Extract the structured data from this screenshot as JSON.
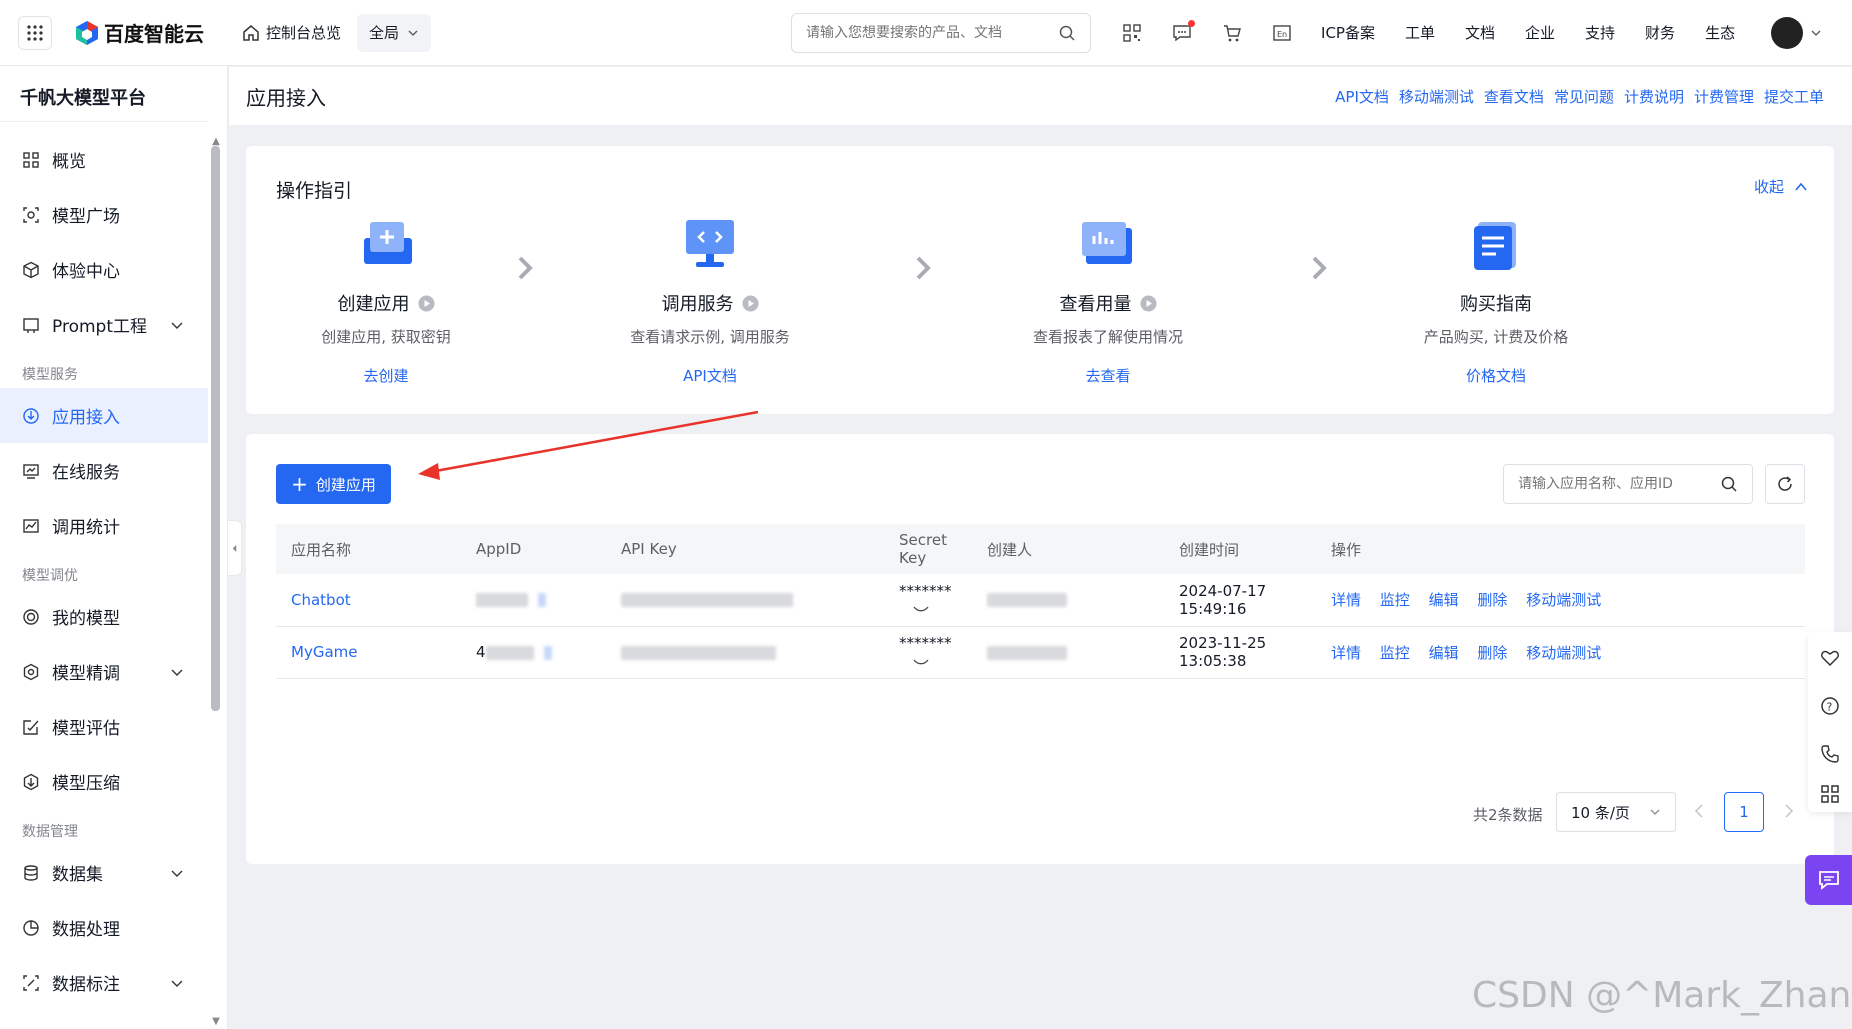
{
  "topbar": {
    "brand": "百度智能云",
    "console_home": "控制台总览",
    "region": "全局",
    "search_placeholder": "请输入您想要搜索的产品、文档",
    "links": [
      "ICP备案",
      "工单",
      "文档",
      "企业",
      "支持",
      "财务",
      "生态"
    ]
  },
  "sidebar": {
    "title": "千帆大模型平台",
    "items_top": [
      {
        "label": "概览",
        "icon": "grid-icon"
      },
      {
        "label": "模型广场",
        "icon": "model-square-icon"
      },
      {
        "label": "体验中心",
        "icon": "cube-icon"
      },
      {
        "label": "Prompt工程",
        "icon": "prompt-icon"
      }
    ],
    "group_model_service": "模型服务",
    "items_service": [
      {
        "label": "应用接入",
        "icon": "download-icon"
      },
      {
        "label": "在线服务",
        "icon": "monitor-icon"
      },
      {
        "label": "调用统计",
        "icon": "chart-icon"
      }
    ],
    "group_model_tuning": "模型调优",
    "items_tuning": [
      {
        "label": "我的模型",
        "icon": "target-icon"
      },
      {
        "label": "模型精调",
        "icon": "gear-icon"
      },
      {
        "label": "模型评估",
        "icon": "evaluate-icon"
      },
      {
        "label": "模型压缩",
        "icon": "compress-icon"
      }
    ],
    "group_data": "数据管理",
    "items_data": [
      {
        "label": "数据集",
        "icon": "database-icon"
      },
      {
        "label": "数据处理",
        "icon": "pie-icon"
      },
      {
        "label": "数据标注",
        "icon": "annotate-icon"
      }
    ]
  },
  "header": {
    "title": "应用接入",
    "links": [
      "API文档",
      "移动端测试",
      "查看文档",
      "常见问题",
      "计费说明",
      "计费管理",
      "提交工单"
    ]
  },
  "guide": {
    "title": "操作指引",
    "collapse_label": "收起",
    "steps": [
      {
        "title": "创建应用",
        "desc": "创建应用, 获取密钥",
        "link": "去创建"
      },
      {
        "title": "调用服务",
        "desc": "查看请求示例, 调用服务",
        "link": "API文档"
      },
      {
        "title": "查看用量",
        "desc": "查看报表了解使用情况",
        "link": "去查看"
      },
      {
        "title": "购买指南",
        "desc": "产品购买, 计费及价格",
        "link": "价格文档"
      }
    ]
  },
  "apps": {
    "create_label": "创建应用",
    "search_placeholder": "请输入应用名称、应用ID",
    "columns": [
      "应用名称",
      "AppID",
      "API Key",
      "Secret Key",
      "创建人",
      "创建时间",
      "操作"
    ],
    "rows": [
      {
        "name": "Chatbot",
        "appid_prefix": "",
        "secret": "*******",
        "created": "2024-07-17 15:49:16"
      },
      {
        "name": "MyGame",
        "appid_prefix": "4",
        "secret": "*******",
        "created": "2023-11-25 13:05:38"
      }
    ],
    "operations": [
      "详情",
      "监控",
      "编辑",
      "删除",
      "移动端测试"
    ],
    "total": "共2条数据",
    "page_size": "10 条/页",
    "current_page": "1"
  },
  "watermark": "CSDN @^Mark_Zhang^"
}
